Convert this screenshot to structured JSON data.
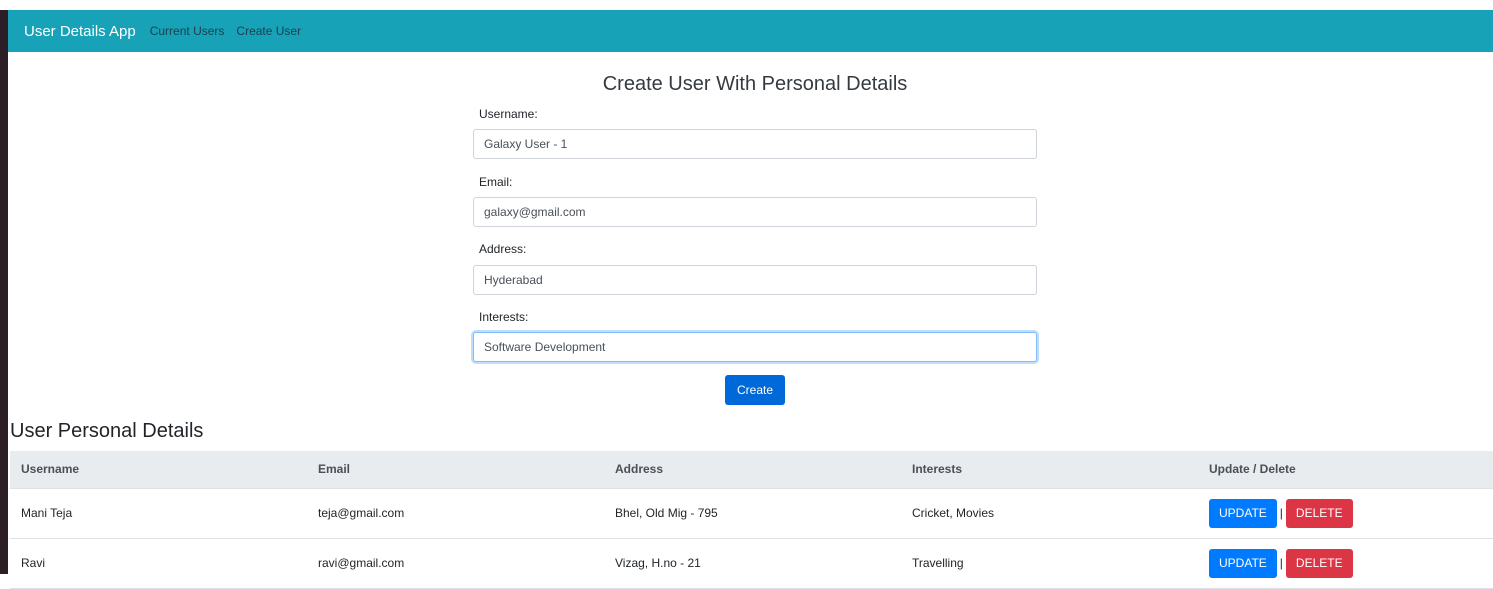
{
  "navbar": {
    "brand": "User Details App",
    "links": [
      "Current Users",
      "Create User"
    ]
  },
  "form": {
    "title": "Create User With Personal Details",
    "fields": [
      {
        "label": "Username:",
        "value": "Galaxy User - 1"
      },
      {
        "label": "Email:",
        "value": "galaxy@gmail.com"
      },
      {
        "label": "Address:",
        "value": "Hyderabad"
      },
      {
        "label": "Interests:",
        "value": "Software Development"
      }
    ],
    "submit_label": "Create"
  },
  "table": {
    "title": "User Personal Details",
    "headers": [
      "Username",
      "Email",
      "Address",
      "Interests",
      "Update / Delete"
    ],
    "rows": [
      [
        "Mani Teja",
        "teja@gmail.com",
        "Bhel, Old Mig - 795",
        "Cricket, Movies"
      ],
      [
        "Ravi",
        "ravi@gmail.com",
        "Vizag, H.no - 21",
        "Travelling"
      ]
    ],
    "update_label": "UPDATE",
    "separator": "|",
    "delete_label": "DELETE"
  },
  "colors": {
    "navbar": "#17a2b8",
    "primary": "#007bff",
    "danger": "#dc3545"
  }
}
